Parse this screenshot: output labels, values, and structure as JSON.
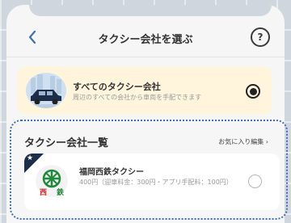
{
  "header": {
    "title": "タクシー会社を選ぶ",
    "help_label": "?"
  },
  "all_option": {
    "title": "すべてのタクシー会社",
    "subtitle": "周辺のすべての会社から車両を手配できます",
    "selected": true
  },
  "list": {
    "title": "タクシー会社一覧",
    "fav_edit_label": "お気に入り編集 ›"
  },
  "companies": [
    {
      "name": "福岡西鉄タクシー",
      "fee": "400円（迎車料金：300円・アプリ手配料：100円）",
      "logo_chars": [
        "西",
        "鉄"
      ],
      "favorite": true,
      "selected": false
    }
  ],
  "colors": {
    "accent_blue": "#3f6fb4",
    "highlight": "#fff5dd",
    "badge": "#1c2d4a",
    "logo_green": "#1e8a3a",
    "logo_red": "#d22a2a"
  },
  "icons": [
    "back-chevron-icon",
    "help-icon",
    "taxi-icon",
    "favorite-star-icon",
    "nishitetsu-logo-icon"
  ]
}
